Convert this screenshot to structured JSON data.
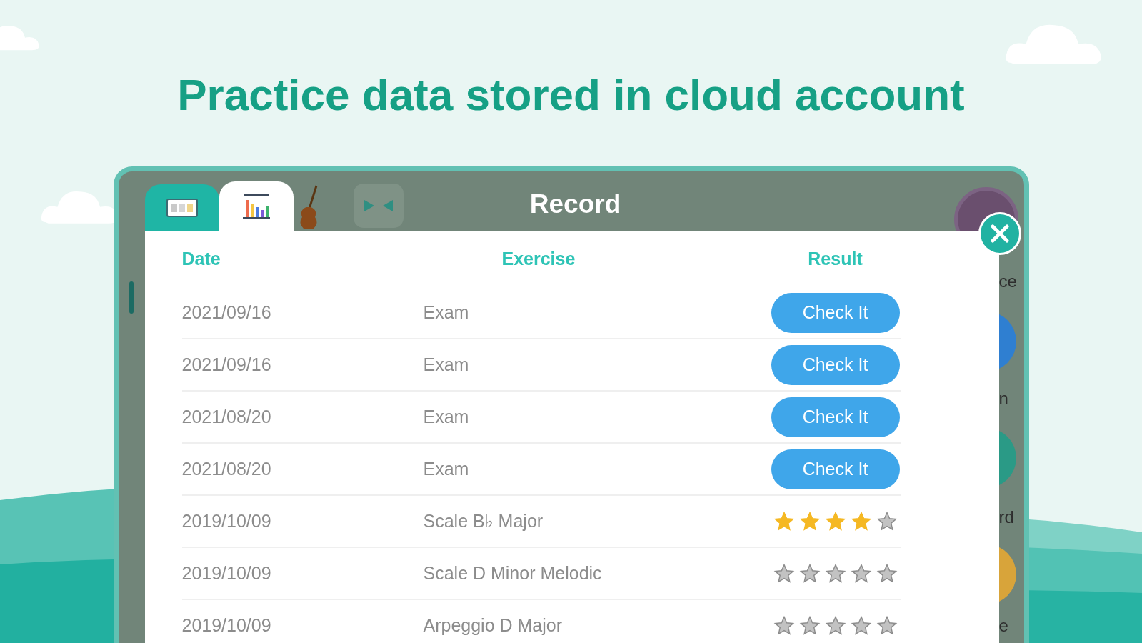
{
  "headline": "Practice data stored in cloud account",
  "window": {
    "title": "Record"
  },
  "tabs": [
    {
      "kind": "board",
      "selected": false
    },
    {
      "kind": "chart",
      "selected": true
    }
  ],
  "side_labels": [
    "ce",
    "n",
    "rd",
    "e"
  ],
  "table": {
    "columns": [
      "Date",
      "Exercise",
      "Result"
    ],
    "rows": [
      {
        "date": "2021/09/16",
        "exercise": "Exam",
        "kind": "button",
        "result": "Check It"
      },
      {
        "date": "2021/09/16",
        "exercise": "Exam",
        "kind": "button",
        "result": "Check It"
      },
      {
        "date": "2021/08/20",
        "exercise": "Exam",
        "kind": "button",
        "result": "Check It"
      },
      {
        "date": "2021/08/20",
        "exercise": "Exam",
        "kind": "button",
        "result": "Check It"
      },
      {
        "date": "2019/10/09",
        "exercise": "Scale B♭ Major",
        "kind": "stars",
        "stars": 4
      },
      {
        "date": "2019/10/09",
        "exercise": "Scale D Minor Melodic",
        "kind": "stars",
        "stars": 0
      },
      {
        "date": "2019/10/09",
        "exercise": "Arpeggio D Major",
        "kind": "stars",
        "stars": 0
      }
    ]
  }
}
